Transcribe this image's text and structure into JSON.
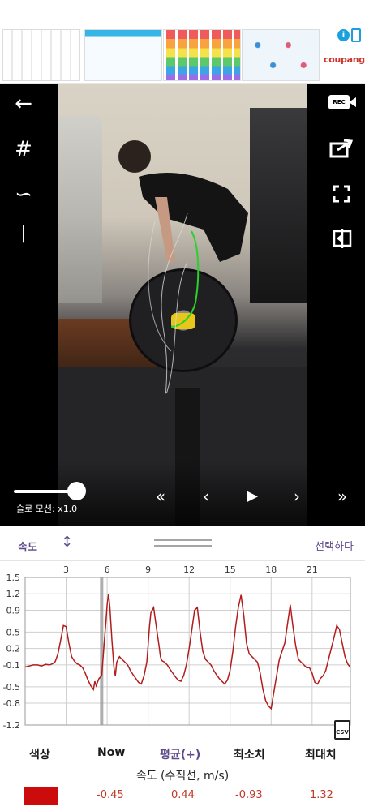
{
  "ad": {
    "brand": "coupang",
    "info_icon": "info-icon",
    "close_icon": "ad-close-icon"
  },
  "video": {
    "slow_motion_label": "슬로 모션: x1.0",
    "slow_motion_value": 1.0,
    "icons": {
      "back": "back-arrow-icon",
      "grid": "grid-icon",
      "path": "bar-path-icon",
      "line": "line-tool-icon",
      "record": "record-icon",
      "share": "share-icon",
      "fullscreen": "fullscreen-icon",
      "compare": "compare-icon"
    },
    "rec_text": "REC"
  },
  "panel": {
    "speed_label": "속도",
    "select_label": "선택하다"
  },
  "chart_data": {
    "type": "line",
    "title": "",
    "xlabel": "",
    "ylabel": "",
    "x_ticks": [
      3,
      6,
      9,
      12,
      15,
      18,
      21
    ],
    "y_ticks": [
      1.5,
      1.2,
      0.9,
      0.5,
      0.2,
      -0.1,
      -0.5,
      -0.8,
      -1.2
    ],
    "xlim": [
      0,
      23.8
    ],
    "ylim": [
      -1.2,
      1.5
    ],
    "now_marker_x": 5.6,
    "grid": true,
    "series": [
      {
        "color": "#b31c1c",
        "x": [
          0,
          0.3,
          0.6,
          0.9,
          1.2,
          1.5,
          1.8,
          2.0,
          2.2,
          2.4,
          2.6,
          2.8,
          3.0,
          3.2,
          3.4,
          3.6,
          3.8,
          4.0,
          4.2,
          4.4,
          4.6,
          4.8,
          5.0,
          5.1,
          5.2,
          5.4,
          5.6,
          5.8,
          5.9,
          6.0,
          6.1,
          6.2,
          6.35,
          6.5,
          6.6,
          6.7,
          6.9,
          7.1,
          7.3,
          7.5,
          7.7,
          7.9,
          8.1,
          8.3,
          8.5,
          8.7,
          8.9,
          9.0,
          9.1,
          9.2,
          9.4,
          9.6,
          9.8,
          9.9,
          10.0,
          10.2,
          10.4,
          10.6,
          10.8,
          11.0,
          11.2,
          11.4,
          11.6,
          11.8,
          12.0,
          12.2,
          12.4,
          12.6,
          12.8,
          13.0,
          13.2,
          13.4,
          13.6,
          13.8,
          14.0,
          14.2,
          14.4,
          14.6,
          14.8,
          15.0,
          15.2,
          15.4,
          15.6,
          15.8,
          16.0,
          16.2,
          16.4,
          16.6,
          16.8,
          17.0,
          17.2,
          17.4,
          17.6,
          17.8,
          18.0,
          18.2,
          18.4,
          18.6,
          18.8,
          19.0,
          19.2,
          19.4,
          19.6,
          19.8,
          20.0,
          20.2,
          20.4,
          20.6,
          20.8,
          21.0,
          21.2,
          21.4,
          21.6,
          21.8,
          22.0,
          22.2,
          22.4,
          22.6,
          22.8,
          23.0,
          23.2,
          23.4,
          23.6,
          23.8
        ],
        "y": [
          -0.14,
          -0.12,
          -0.1,
          -0.1,
          -0.12,
          -0.09,
          -0.1,
          -0.08,
          -0.04,
          0.1,
          0.35,
          0.62,
          0.6,
          0.3,
          0.05,
          -0.03,
          -0.08,
          -0.1,
          -0.15,
          -0.25,
          -0.38,
          -0.48,
          -0.55,
          -0.4,
          -0.48,
          -0.35,
          -0.3,
          0.35,
          0.65,
          1.0,
          1.2,
          0.95,
          0.35,
          -0.15,
          -0.3,
          -0.05,
          0.05,
          0.0,
          -0.05,
          -0.1,
          -0.2,
          -0.28,
          -0.35,
          -0.42,
          -0.45,
          -0.3,
          -0.05,
          0.25,
          0.6,
          0.85,
          0.95,
          0.6,
          0.25,
          0.05,
          -0.02,
          -0.05,
          -0.1,
          -0.18,
          -0.25,
          -0.32,
          -0.38,
          -0.4,
          -0.3,
          -0.1,
          0.2,
          0.55,
          0.9,
          0.95,
          0.5,
          0.15,
          0.0,
          -0.05,
          -0.1,
          -0.2,
          -0.28,
          -0.35,
          -0.4,
          -0.45,
          -0.38,
          -0.2,
          0.15,
          0.6,
          0.95,
          1.18,
          0.8,
          0.3,
          0.1,
          0.05,
          0.0,
          -0.05,
          -0.25,
          -0.55,
          -0.75,
          -0.85,
          -0.9,
          -0.6,
          -0.3,
          0.0,
          0.15,
          0.3,
          0.65,
          1.0,
          0.6,
          0.25,
          0.0,
          -0.05,
          -0.1,
          -0.15,
          -0.15,
          -0.25,
          -0.42,
          -0.45,
          -0.35,
          -0.3,
          -0.2,
          0.0,
          0.2,
          0.4,
          0.62,
          0.55,
          0.3,
          0.05,
          -0.08,
          -0.15
        ]
      }
    ]
  },
  "stats": {
    "headers": {
      "color": "색상",
      "now": "Now",
      "mean": "평균(+)",
      "min": "최소치",
      "max": "최대치"
    },
    "title": "속도 (수직선, m/s)",
    "swatch_color": "#cc0c0c",
    "values": {
      "now": "-0.45",
      "mean": "0.44",
      "min": "-0.93",
      "max": "1.32"
    }
  },
  "csv_text": "CSV"
}
